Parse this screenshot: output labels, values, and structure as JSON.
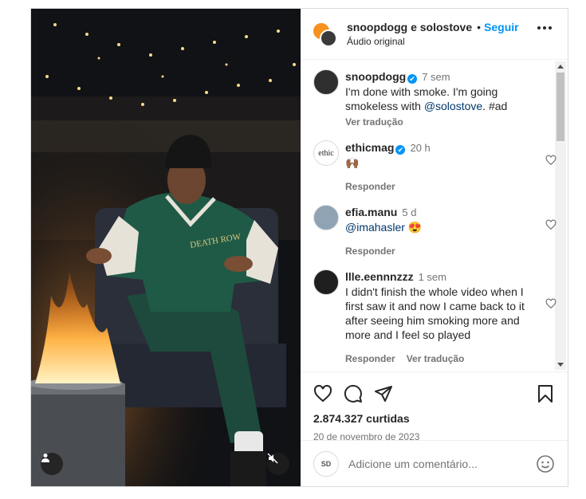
{
  "header": {
    "title": "snoopdogg e solostove",
    "separator": "•",
    "follow_label": "Seguir",
    "audio": "Áudio original",
    "more_icon": "more-horizontal-icon"
  },
  "comments": [
    {
      "user": "snoopdogg",
      "verified": "✔",
      "time": "7 sem",
      "text_before": "I'm done with smoke. I'm going smokeless with ",
      "mention": "@solostove",
      "text_after": ". #ad",
      "meta": [
        "Ver tradução"
      ],
      "avatar_color": "#2f2f2f",
      "has_like": false
    },
    {
      "user": "ethicmag",
      "verified": "✔",
      "time": "20 h",
      "text_before": "🙌🏾",
      "mention": "",
      "text_after": "",
      "meta": [
        "Responder"
      ],
      "avatar_label": "ethic",
      "has_like": true
    },
    {
      "user": "efia.manu",
      "verified": "",
      "time": "5 d",
      "text_before": "",
      "mention": "@imahasler",
      "text_after": " 😍",
      "meta": [
        "Responder"
      ],
      "avatar_color": "#8fa3b4",
      "has_like": true
    },
    {
      "user": "llle.eennnzzz",
      "verified": "",
      "time": "1 sem",
      "text_before": "I didn't finish the whole video when I first saw it and now I came back to it after seeing him smoking more and more and I feel so played",
      "mention": "",
      "text_after": "",
      "meta": [
        "Responder",
        "Ver tradução"
      ],
      "avatar_color": "#1f1f1f",
      "has_like": true
    }
  ],
  "actions": {
    "likes": "2.874.327 curtidas",
    "date": "20 de novembro de 2023",
    "icons": [
      "heart-icon",
      "comment-icon",
      "share-icon",
      "bookmark-icon"
    ]
  },
  "add_comment": {
    "placeholder": "Adicione um comentário...",
    "avatar_label": "SD"
  },
  "media": {
    "icons": [
      "user-tag-icon",
      "mute-icon"
    ]
  }
}
